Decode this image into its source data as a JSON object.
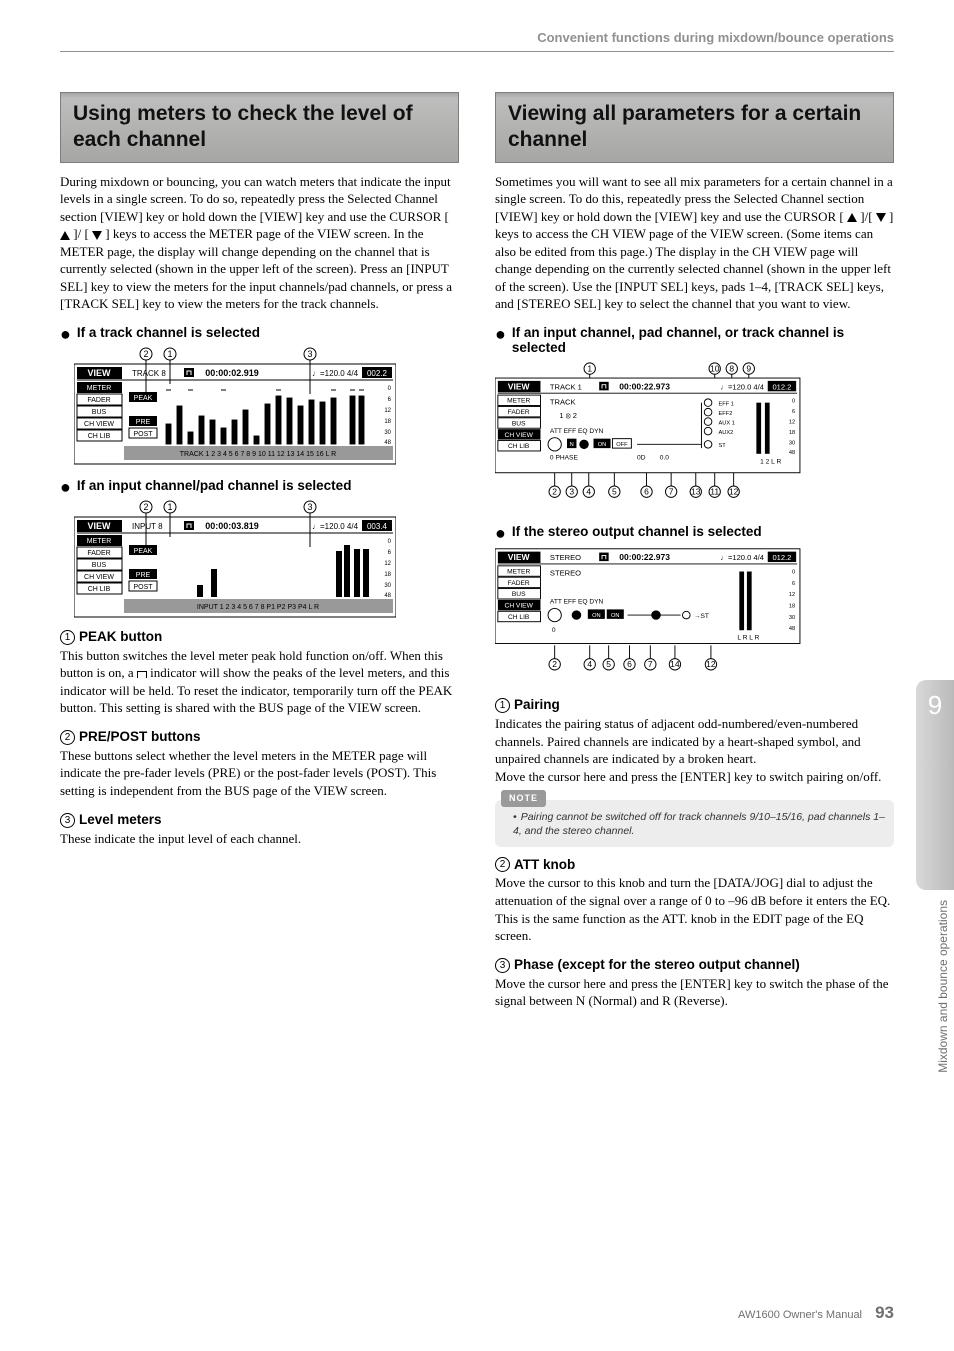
{
  "running_head": "Convenient functions during mixdown/bounce operations",
  "left": {
    "title": "Using meters to check the level of each channel",
    "intro_before": "During mixdown or bouncing, you can watch meters that indicate the input levels in a single screen. To do so, repeatedly press the Selected Channel section [VIEW] key or hold down the [VIEW] key and use the CURSOR [ ",
    "intro_mid": " ]/ [ ",
    "intro_after": " ] keys to access the METER page of the VIEW screen. In the METER page, the display will change depending on the channel that is currently selected (shown in the upper left of the screen). Press an [INPUT SEL] key to view the meters for the input channels/pad channels, or press a [TRACK SEL] key to view the meters for the track channels.",
    "sub1": "If a track channel is selected",
    "sub2": "If an input channel/pad channel is selected",
    "item1_h": "PEAK button",
    "item1_b_before": "This button switches the level meter peak hold function on/off. When this button is on, a ",
    "item1_b_after": " indicator will show the peaks of the level meters, and this indicator will be held. To reset the indicator, temporarily turn off the PEAK button. This setting is shared with the BUS page of the VIEW screen.",
    "item2_h": "PRE/POST buttons",
    "item2_b": "These buttons select whether the level meters in the METER page will indicate the pre-fader levels (PRE) or the post-fader levels (POST). This setting is independent from the BUS page of the VIEW screen.",
    "item3_h": "Level meters",
    "item3_b": "These indicate the input level of each channel."
  },
  "right": {
    "title": "Viewing all parameters for a certain channel",
    "intro_before": "Sometimes you will want to see all mix parameters for a certain channel in a single screen. To do this, repeatedly press the Selected Channel section [VIEW] key or hold down the [VIEW] key and use the CURSOR [ ",
    "intro_mid": " ]/[ ",
    "intro_after": " ] keys to access the CH VIEW page of the VIEW screen. (Some items can also be edited from this page.) The display in the CH VIEW page will change depending on the currently selected channel (shown in the upper left of the screen). Use the [INPUT SEL] keys, pads 1–4, [TRACK SEL] keys, and [STEREO SEL] key to select the channel that you want to view.",
    "sub1": "If an input channel, pad channel, or track channel is selected",
    "sub2": "If the stereo output channel is selected",
    "item1_h": "Pairing",
    "item1_b": "Indicates the pairing status of adjacent odd-numbered/even-numbered channels. Paired channels are indicated by a heart-shaped symbol, and unpaired channels are indicated by a broken heart.\nMove the cursor here and press the [ENTER] key to switch pairing on/off.",
    "note": "Pairing cannot be switched off for track channels 9/10–15/16, pad channels 1–4, and the stereo channel.",
    "note_tag": "NOTE",
    "item2_h": "ATT knob",
    "item2_b": "Move the cursor to this knob and turn the [DATA/JOG] dial to adjust the attenuation of the signal over a range of 0 to –96 dB before it enters the EQ. This is the same function as the ATT. knob in the EDIT page of the EQ screen.",
    "item3_h": "Phase (except for the stereo output channel)",
    "item3_b": "Move the cursor here and press the [ENTER] key to switch the phase of the signal between N (Normal) and R (Reverse)."
  },
  "side": {
    "chapter": "9",
    "vtext": "Mixdown and bounce operations"
  },
  "footer": {
    "manual": "AW1600  Owner's Manual",
    "page": "93"
  },
  "screens": {
    "s1": {
      "title": "VIEW",
      "track": "TRACK   8",
      "time": "00:00:02.919",
      "tempo": "♩=120.0 4/4",
      "bar": "002.2",
      "tabs": [
        "METER",
        "FADER",
        "BUS",
        "CH VIEW",
        "CH LIB"
      ],
      "btns": [
        "PEAK",
        "PRE",
        "POST"
      ],
      "footer": "TRACK  1  2  3  4  5  6  7  8  9 10 11 12 13 14 15 16   L R",
      "scale": [
        "0",
        "6",
        "12",
        "18",
        "30",
        "48"
      ]
    },
    "s2": {
      "title": "VIEW",
      "track": "INPUT 8",
      "time": "00:00:03.819",
      "tempo": "♩=120.0 4/4",
      "bar": "003.4",
      "tabs": [
        "METER",
        "FADER",
        "BUS",
        "CH VIEW",
        "CH LIB"
      ],
      "btns": [
        "PEAK",
        "PRE",
        "POST"
      ],
      "footer": "INPUT   1   2   3   4   5   6   7   8   P1   P2   P3   P4    L R",
      "scale": [
        "0",
        "6",
        "12",
        "18",
        "30",
        "48"
      ]
    },
    "s3": {
      "title": "VIEW",
      "track": "TRACK   1",
      "time": "00:00:22.973",
      "tempo": "♩=120.0 4/4",
      "bar": "012.2",
      "tabs": [
        "METER",
        "FADER",
        "BUS",
        "CH VIEW",
        "CH LIB"
      ],
      "row2": "TRACK",
      "row3": "1  ⦻ 2",
      "labels": "ATT    EFF    EQ    DYN",
      "onoff": "ON   OFF",
      "phase": "0 PHASE",
      "ondb": "0D",
      "gain": "0.0",
      "sends": [
        "EFF 1",
        "EFF2",
        "AUX 1",
        "AUX2",
        "ST"
      ],
      "panrow": "1   2   L R",
      "scale": [
        "0",
        "6",
        "12",
        "18",
        "30",
        "48"
      ]
    },
    "s4": {
      "title": "VIEW",
      "track": "STEREO",
      "time": "00:00:22.973",
      "tempo": "♩=120.0 4/4",
      "bar": "012.2",
      "tabs": [
        "METER",
        "FADER",
        "BUS",
        "CH VIEW",
        "CH LIB"
      ],
      "row2": "STEREO",
      "labels": "ATT    EFF    EQ    DYN",
      "onoff": "ON   ON",
      "zero": "0",
      "st": "→ST",
      "panrow": "L R   L R",
      "scale": [
        "0",
        "6",
        "12",
        "18",
        "30",
        "48"
      ]
    }
  }
}
